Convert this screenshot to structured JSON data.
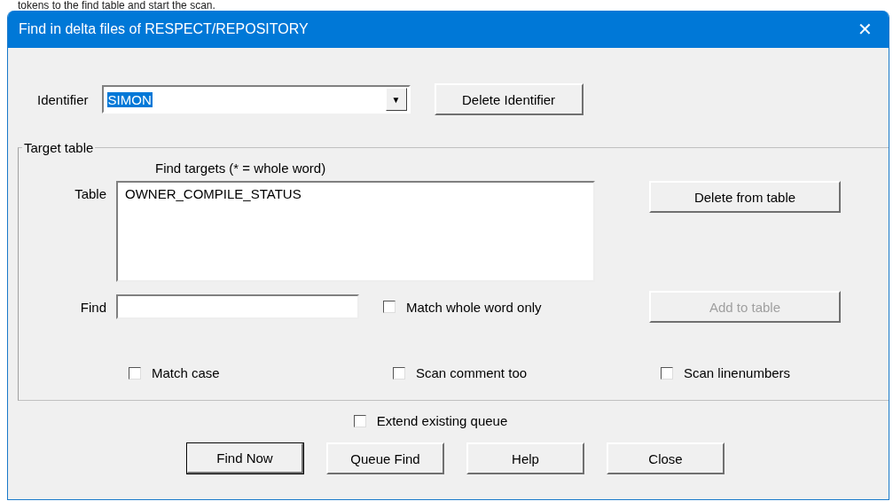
{
  "background_text": "tokens to the find table and start the scan.",
  "window": {
    "title": "Find in delta files of RESPECT/REPOSITORY",
    "close": "✕"
  },
  "identifier": {
    "label": "Identifier",
    "value": "SIMON",
    "highlighted": true,
    "dropdown": "▼",
    "button": {
      "label": "Delete Identifier",
      "disabled": false,
      "default": false
    }
  },
  "target_table": {
    "legend": "Target table",
    "caption": "Find targets (* = whole word)",
    "table_label": "Table",
    "items": [
      "OWNER_COMPILE_STATUS"
    ],
    "delete_button": {
      "label": "Delete from table",
      "disabled": false,
      "default": false
    },
    "find_label": "Find",
    "match_whole_word": {
      "label": "Match whole word only",
      "checked": false
    },
    "add_button": {
      "label": "Add to table",
      "disabled": true,
      "default": false
    },
    "options": [
      {
        "label": "Match case",
        "checked": false
      },
      {
        "label": "Scan comment too",
        "checked": false
      },
      {
        "label": "Scan linenumbers",
        "checked": false
      }
    ]
  },
  "extend_queue": {
    "label": "Extend existing queue",
    "checked": false
  },
  "buttons": [
    {
      "label": "Find Now",
      "disabled": false,
      "default": true
    },
    {
      "label": "Queue Find",
      "disabled": false,
      "default": false
    },
    {
      "label": "Help",
      "disabled": false,
      "default": false
    },
    {
      "label": "Close",
      "disabled": false,
      "default": false
    }
  ]
}
